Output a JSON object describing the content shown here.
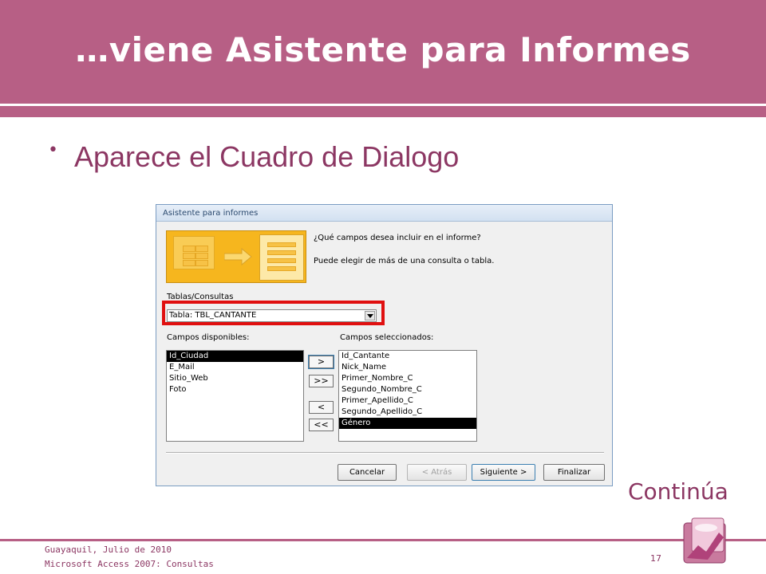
{
  "slide": {
    "title": "…viene Asistente para Informes",
    "bullet": "Aparece el Cuadro de Dialogo",
    "continue_label": "Continúa",
    "footer_place": "Guayaquil, Julio de 2010",
    "footer_course": "Microsoft Access 2007: Consultas",
    "page_number": "17"
  },
  "dialog": {
    "title": "Asistente para informes",
    "question": "¿Qué campos desea incluir en el informe?",
    "hint": "Puede elegir de más de una consulta o tabla.",
    "tables_label": "Tablas/Consultas",
    "selected_table": "Tabla: TBL_CANTANTE",
    "available_label": "Campos disponibles:",
    "selected_label": "Campos seleccionados:",
    "available_fields": [
      "Id_Ciudad",
      "E_Mail",
      "Sitio_Web",
      "Foto"
    ],
    "available_selected_index": 0,
    "selected_fields": [
      "Id_Cantante",
      "Nick_Name",
      "Primer_Nombre_C",
      "Segundo_Nombre_C",
      "Primer_Apellido_C",
      "Segundo_Apellido_C",
      "Género"
    ],
    "selected_selected_index": 6,
    "move_buttons": {
      "add_one": ">",
      "add_all": ">>",
      "remove_one": "<",
      "remove_all": "<<"
    },
    "buttons": {
      "cancel": "Cancelar",
      "back": "< Atrás",
      "next": "Siguiente >",
      "finish": "Finalizar"
    }
  },
  "colors": {
    "accent": "#b75f85",
    "text_accent": "#8c3763",
    "highlight_box": "#e01010"
  },
  "icons": {
    "logo": "access-2007-logo-icon",
    "wizard_art": "report-wizard-icon",
    "dropdown": "chevron-down-icon"
  }
}
